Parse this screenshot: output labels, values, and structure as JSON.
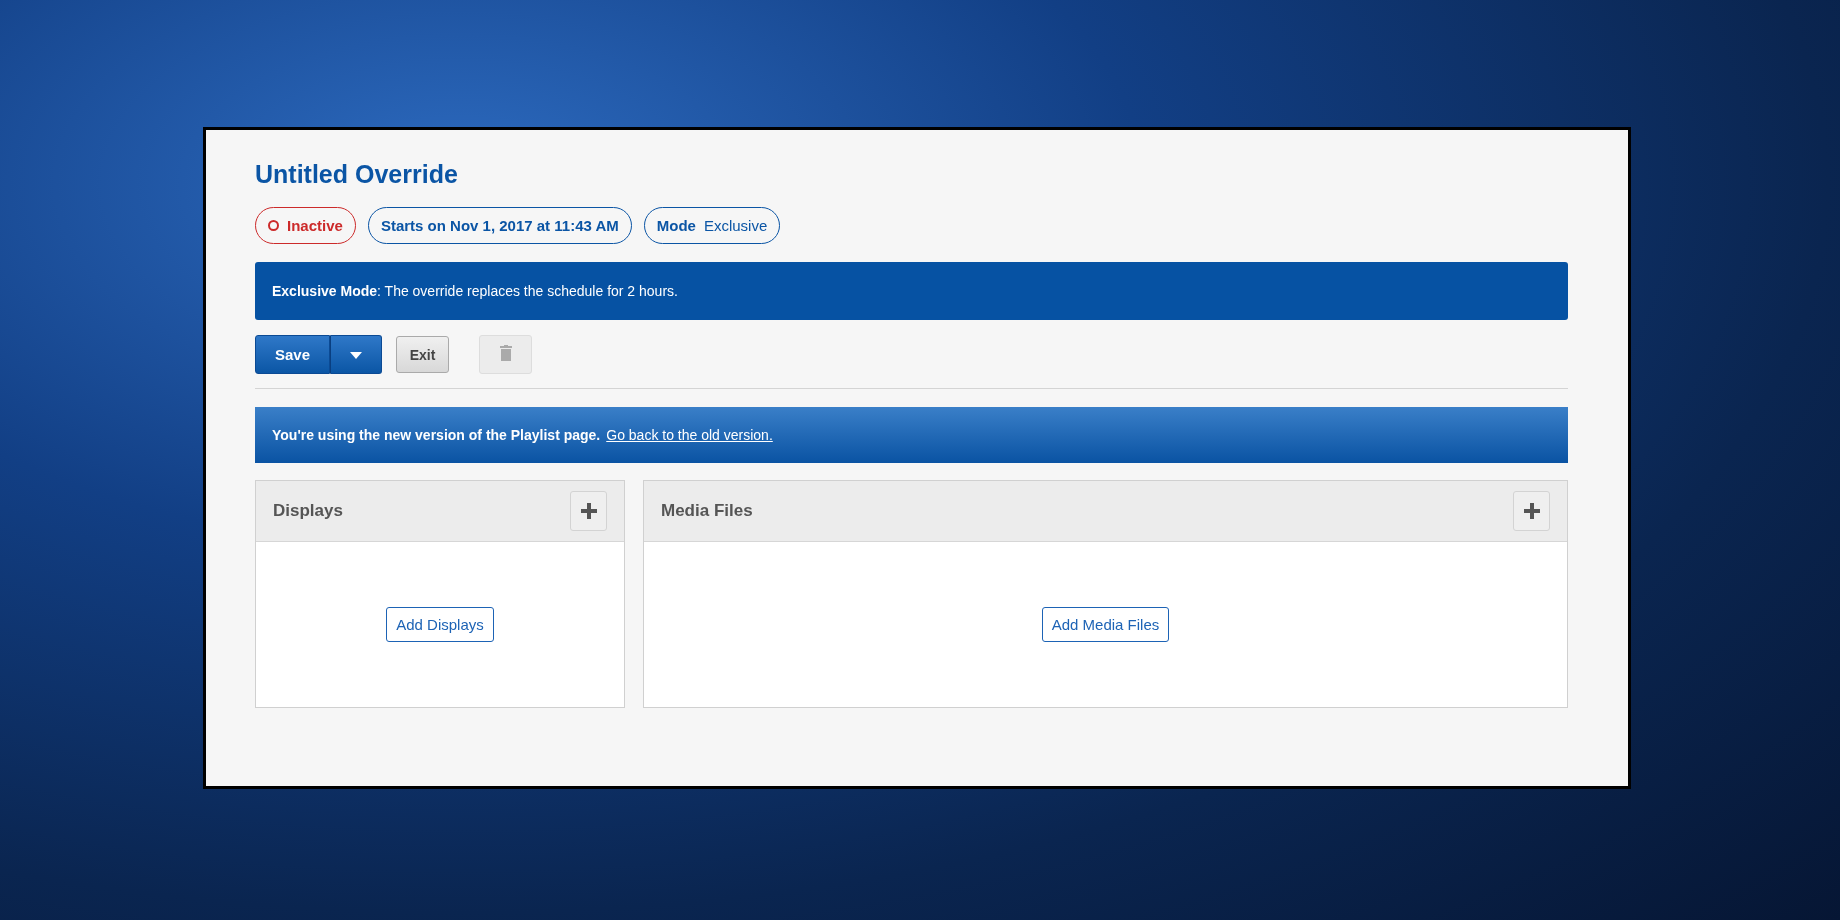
{
  "title": "Untitled Override",
  "status": {
    "label": "Inactive",
    "active": false
  },
  "schedule": {
    "text": "Starts on Nov 1, 2017 at 11:43 AM"
  },
  "mode": {
    "label": "Mode",
    "value": "Exclusive"
  },
  "mode_banner": {
    "text": "**Exclusive Mode**: The override replaces the schedule for 2 hours."
  },
  "toolbar": {
    "save": "Save",
    "exit": "Exit",
    "delete": {
      "disabled": true
    }
  },
  "notice": {
    "text": "You're using the new version of the Playlist page.",
    "link": "Go back to the old version."
  },
  "panels": [
    {
      "title": "Displays",
      "action": "Add Displays"
    },
    {
      "title": "Media Files",
      "action": "Add Media Files"
    }
  ]
}
